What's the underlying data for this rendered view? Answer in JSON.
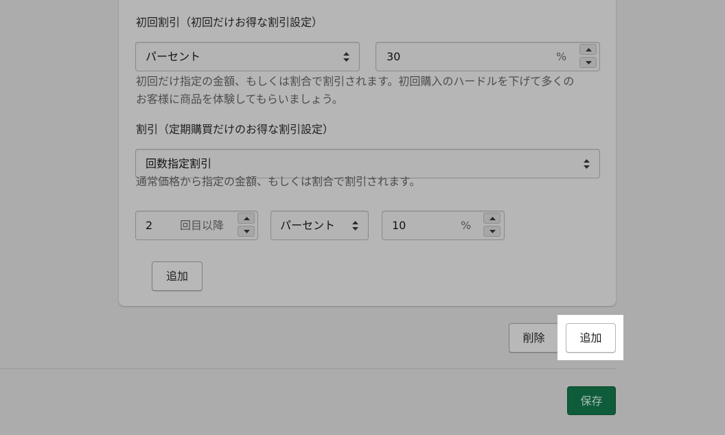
{
  "first_discount": {
    "label": "初回割引（初回だけお得な割引設定）",
    "type_value": "パーセント",
    "amount_value": "30",
    "unit": "%",
    "help": [
      "初回だけ指定の金額、もしくは割合で割引されます。初回購入のハードルを下げて多くの",
      "お客様に商品を体験してもらいましょう。"
    ]
  },
  "discount": {
    "label": "割引（定期購買だけのお得な割引設定）",
    "method_value": "回数指定割引",
    "help": "通常価格から指定の金額、もしくは割合で割引されます。",
    "tier": {
      "count_value": "2",
      "count_suffix": "回目以降",
      "type_value": "パーセント",
      "amount_value": "10",
      "unit": "%"
    },
    "add_label": "追加"
  },
  "actions": {
    "delete_label": "削除",
    "add_label": "追加"
  },
  "footer": {
    "save_label": "保存"
  },
  "colors": {
    "save_bg": "#0e5c3a",
    "highlight": "#ffffff",
    "overlay": "#acacac"
  },
  "icons": [
    "updown-icon",
    "caret-up-icon",
    "caret-down-icon"
  ]
}
